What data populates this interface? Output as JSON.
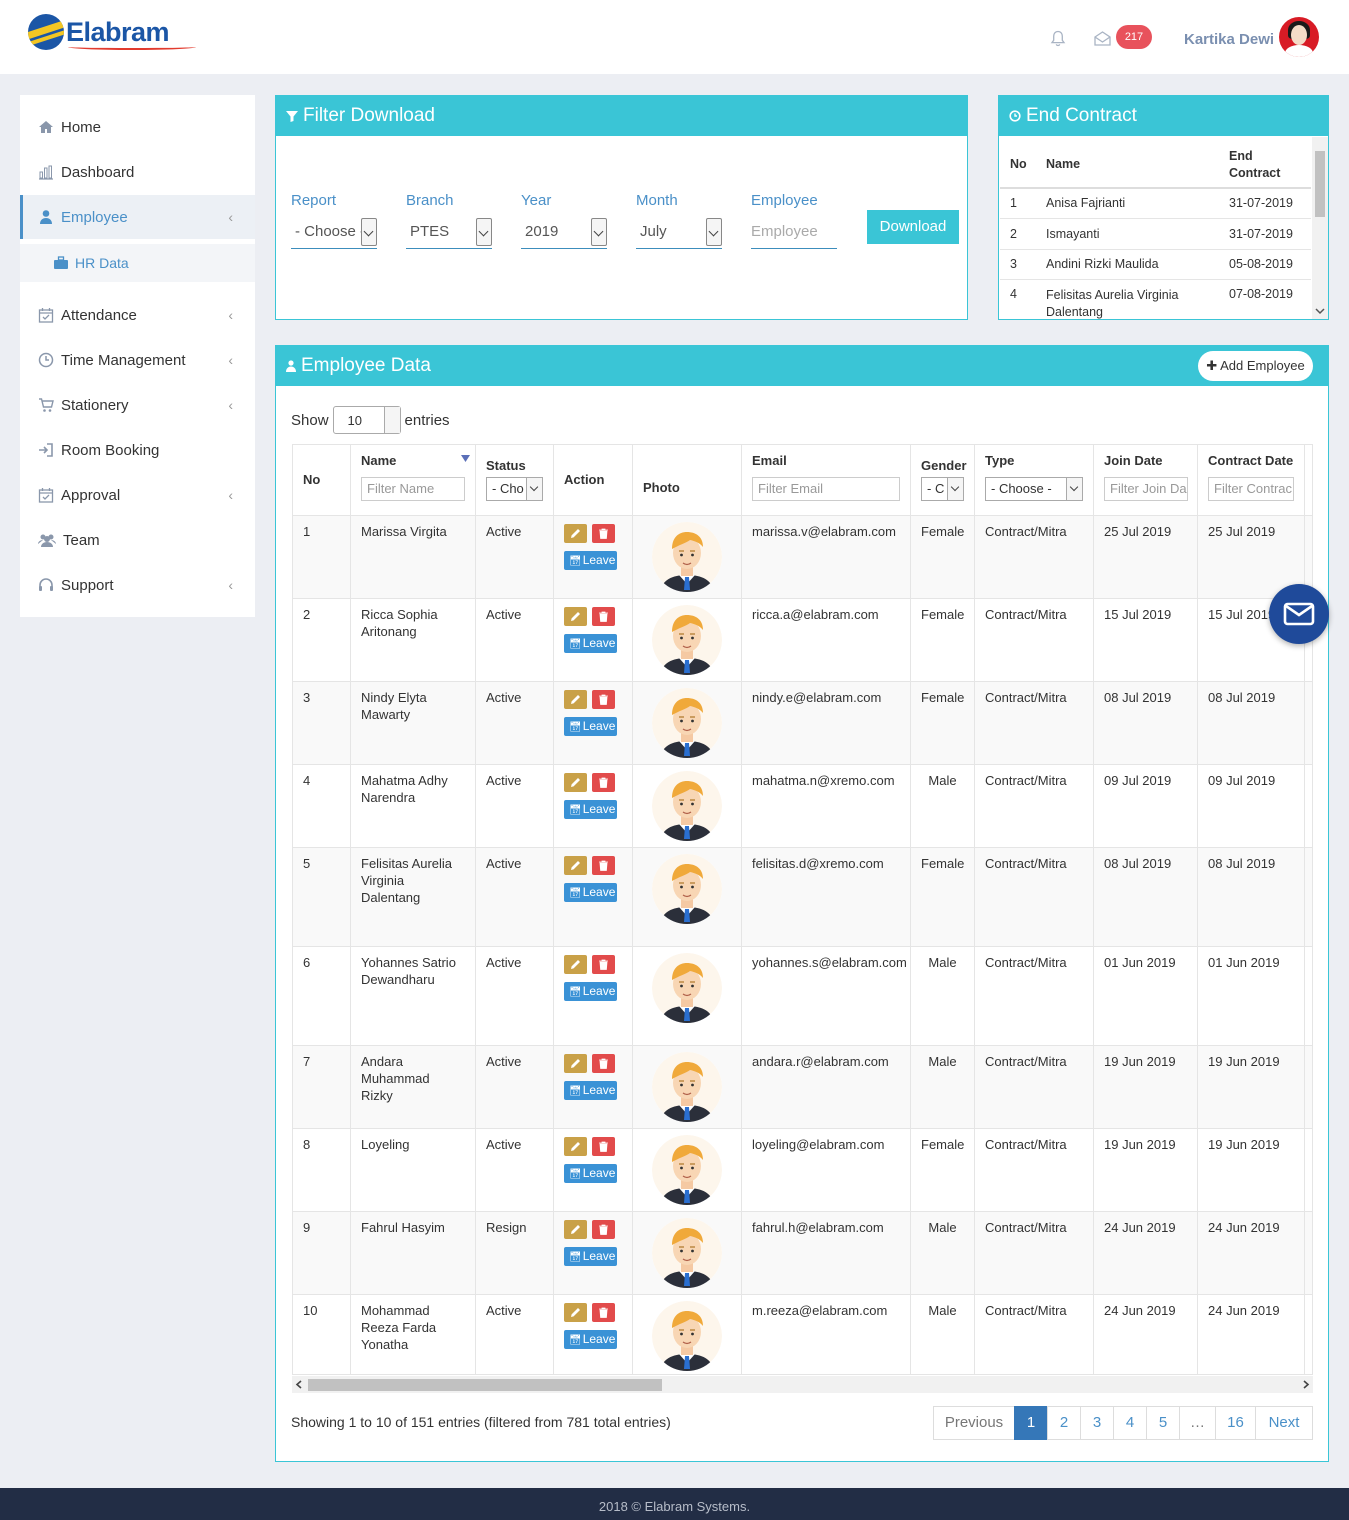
{
  "header": {
    "logo_text": "Elabram",
    "notification_badge": "217",
    "user_name": "Kartika Dewi"
  },
  "sidebar": {
    "items": [
      {
        "label": "Home",
        "icon": "home-icon"
      },
      {
        "label": "Dashboard",
        "icon": "bar-chart-icon"
      },
      {
        "label": "Employee",
        "icon": "user-icon"
      },
      {
        "label": "Attendance",
        "icon": "calendar-check-icon"
      },
      {
        "label": "Time Management",
        "icon": "clock-icon"
      },
      {
        "label": "Stationery",
        "icon": "cart-icon"
      },
      {
        "label": "Room Booking",
        "icon": "sign-in-icon"
      },
      {
        "label": "Approval",
        "icon": "calendar-check-icon"
      },
      {
        "label": "Team",
        "icon": "users-icon"
      },
      {
        "label": "Support",
        "icon": "headset-icon"
      }
    ],
    "sub_item": "HR Data"
  },
  "filter_download": {
    "title": "Filter Download",
    "report_label": "Report",
    "report_value": "- Choose -",
    "branch_label": "Branch",
    "branch_value": "PTES",
    "year_label": "Year",
    "year_value": "2019",
    "month_label": "Month",
    "month_value": "July",
    "employee_label": "Employee",
    "employee_placeholder": "Employee",
    "download_label": "Download"
  },
  "end_contract": {
    "title": "End Contract",
    "headers": {
      "no": "No",
      "name": "Name",
      "end_line1": "End",
      "end_line2": "Contract"
    },
    "rows": [
      {
        "no": "1",
        "name": "Anisa Fajrianti",
        "date": "31-07-2019"
      },
      {
        "no": "2",
        "name": "Ismayanti",
        "date": "31-07-2019"
      },
      {
        "no": "3",
        "name": "Andini Rizki Maulida",
        "date": "05-08-2019"
      },
      {
        "no": "4",
        "name": "Felisitas Aurelia Virginia Dalentang",
        "date": "07-08-2019"
      }
    ]
  },
  "employee_data": {
    "title": "Employee Data",
    "add_label": "Add Employee",
    "show_label": "Show",
    "entries_value": "10",
    "entries_label": "entries",
    "headers": {
      "no": "No",
      "name": "Name",
      "status": "Status",
      "action": "Action",
      "photo": "Photo",
      "email": "Email",
      "gender": "Gender",
      "type": "Type",
      "join": "Join Date",
      "contract": "Contract Date"
    },
    "filters": {
      "name": "Filter Name",
      "status": "- Cho",
      "email": "Filter Email",
      "gender": "- C",
      "type": "- Choose -",
      "join": "Filter Join Da",
      "contract": "Filter Contrac"
    },
    "leave_label": "Leave",
    "rows": [
      {
        "no": "1",
        "name": "Marissa Virgita",
        "status": "Active",
        "email": "marissa.v@elabram.com",
        "gender": "Female",
        "type": "Contract/Mitra",
        "join": "25 Jul 2019",
        "contract": "25 Jul 2019"
      },
      {
        "no": "2",
        "name": "Ricca Sophia Aritonang",
        "status": "Active",
        "email": "ricca.a@elabram.com",
        "gender": "Female",
        "type": "Contract/Mitra",
        "join": "15 Jul 2019",
        "contract": "15 Jul 2019"
      },
      {
        "no": "3",
        "name": "Nindy Elyta Mawarty",
        "status": "Active",
        "email": "nindy.e@elabram.com",
        "gender": "Female",
        "type": "Contract/Mitra",
        "join": "08 Jul 2019",
        "contract": "08 Jul 2019"
      },
      {
        "no": "4",
        "name": "Mahatma Adhy Narendra",
        "status": "Active",
        "email": "mahatma.n@xremo.com",
        "gender": "Male",
        "type": "Contract/Mitra",
        "join": "09 Jul 2019",
        "contract": "09 Jul 2019"
      },
      {
        "no": "5",
        "name": "Felisitas Aurelia Virginia Dalentang",
        "status": "Active",
        "email": "felisitas.d@xremo.com",
        "gender": "Female",
        "type": "Contract/Mitra",
        "join": "08 Jul 2019",
        "contract": "08 Jul 2019"
      },
      {
        "no": "6",
        "name": "Yohannes Satrio Dewandharu",
        "status": "Active",
        "email": "yohannes.s@elabram.com",
        "gender": "Male",
        "type": "Contract/Mitra",
        "join": "01 Jun 2019",
        "contract": "01 Jun 2019"
      },
      {
        "no": "7",
        "name": "Andara Muhammad Rizky",
        "status": "Active",
        "email": "andara.r@elabram.com",
        "gender": "Male",
        "type": "Contract/Mitra",
        "join": "19 Jun 2019",
        "contract": "19 Jun 2019"
      },
      {
        "no": "8",
        "name": "Loyeling",
        "status": "Active",
        "email": "loyeling@elabram.com",
        "gender": "Female",
        "type": "Contract/Mitra",
        "join": "19 Jun 2019",
        "contract": "19 Jun 2019"
      },
      {
        "no": "9",
        "name": "Fahrul Hasyim",
        "status": "Resign",
        "email": "fahrul.h@elabram.com",
        "gender": "Male",
        "type": "Contract/Mitra",
        "join": "24 Jun 2019",
        "contract": "24 Jun 2019"
      },
      {
        "no": "10",
        "name": "Mohammad Reeza Farda Yonatha",
        "status": "Active",
        "email": "m.reeza@elabram.com",
        "gender": "Male",
        "type": "Contract/Mitra",
        "join": "24 Jun 2019",
        "contract": "24 Jun 2019"
      }
    ],
    "info": "Showing 1 to 10 of 151 entries (filtered from 781 total entries)",
    "pagination": [
      "Previous",
      "1",
      "2",
      "3",
      "4",
      "5",
      "…",
      "16",
      "Next"
    ]
  },
  "footer": {
    "text": "2018 © Elabram Systems."
  },
  "colors": {
    "accent": "#3ac5d6",
    "link": "#4a90c8",
    "badge": "#e8525c",
    "footer_bg": "#222d45"
  }
}
